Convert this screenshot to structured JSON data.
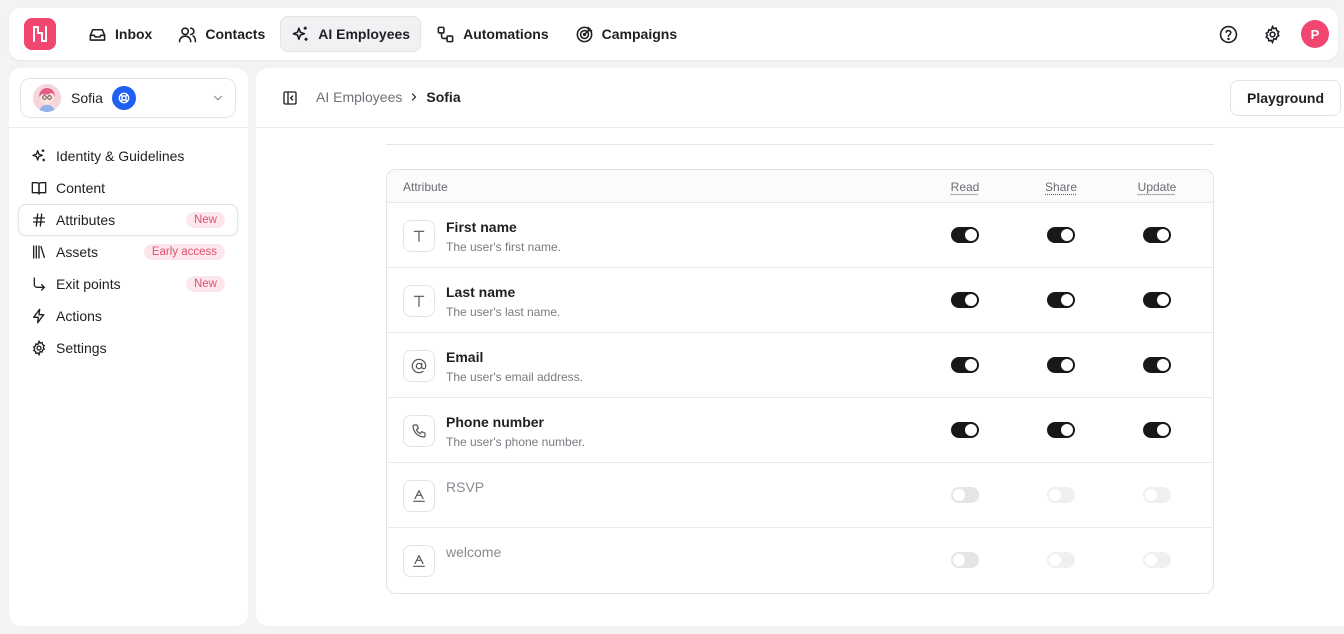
{
  "nav": {
    "items": [
      {
        "label": "Inbox",
        "icon": "inbox-icon",
        "active": false
      },
      {
        "label": "Contacts",
        "icon": "contacts-icon",
        "active": false
      },
      {
        "label": "AI Employees",
        "icon": "sparkles-icon",
        "active": true
      },
      {
        "label": "Automations",
        "icon": "automations-icon",
        "active": false
      },
      {
        "label": "Campaigns",
        "icon": "campaigns-icon",
        "active": false
      }
    ],
    "user_initial": "P",
    "brand_color": "#f0466f"
  },
  "sidebar": {
    "agent_name": "Sofia",
    "items": [
      {
        "label": "Identity & Guidelines",
        "icon": "sparkles-icon",
        "tag": ""
      },
      {
        "label": "Content",
        "icon": "book-icon",
        "tag": ""
      },
      {
        "label": "Attributes",
        "icon": "hash-icon",
        "tag": "New",
        "active": true
      },
      {
        "label": "Assets",
        "icon": "library-icon",
        "tag": "Early access"
      },
      {
        "label": "Exit points",
        "icon": "exit-arrow-icon",
        "tag": "New"
      },
      {
        "label": "Actions",
        "icon": "lightning-icon",
        "tag": ""
      },
      {
        "label": "Settings",
        "icon": "gear-icon",
        "tag": ""
      }
    ]
  },
  "header": {
    "breadcrumb_parent": "AI Employees",
    "breadcrumb_current": "Sofia",
    "playground_label": "Playground"
  },
  "table": {
    "columns": {
      "attribute": "Attribute",
      "read": "Read",
      "share": "Share",
      "update": "Update"
    },
    "rows": [
      {
        "name": "First name",
        "description": "The user's first name.",
        "type_icon": "text-type-icon",
        "read": true,
        "share": true,
        "update": true,
        "enabled": true
      },
      {
        "name": "Last name",
        "description": "The user's last name.",
        "type_icon": "text-type-icon",
        "read": true,
        "share": true,
        "update": true,
        "enabled": true
      },
      {
        "name": "Email",
        "description": "The user's email address.",
        "type_icon": "at-sign-icon",
        "read": true,
        "share": true,
        "update": true,
        "enabled": true
      },
      {
        "name": "Phone number",
        "description": "The user's phone number.",
        "type_icon": "phone-icon",
        "read": true,
        "share": true,
        "update": true,
        "enabled": true
      },
      {
        "name": "RSVP",
        "description": "",
        "type_icon": "custom-text-icon",
        "read": false,
        "share": false,
        "update": false,
        "enabled": false
      },
      {
        "name": "welcome",
        "description": "",
        "type_icon": "custom-text-icon",
        "read": false,
        "share": false,
        "update": false,
        "enabled": false
      }
    ]
  }
}
